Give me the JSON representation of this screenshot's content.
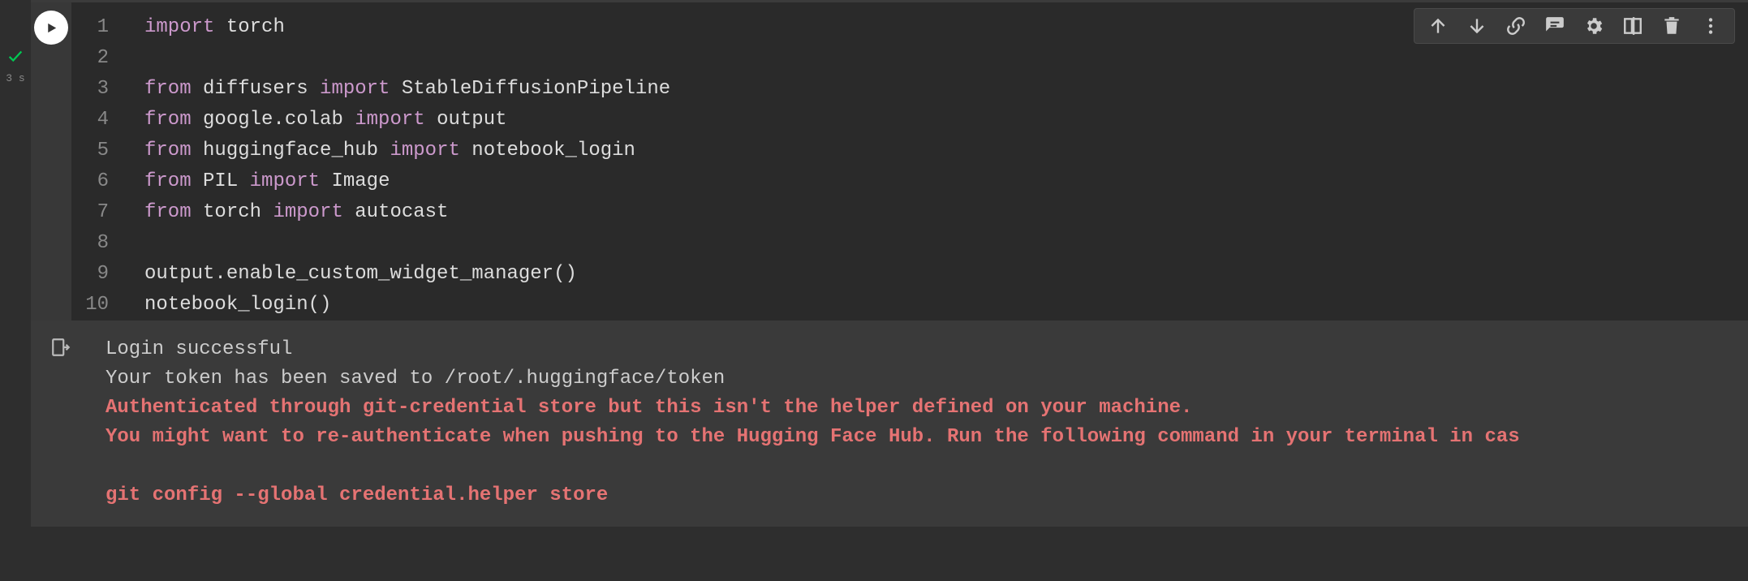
{
  "status": {
    "exec_time": "3 s"
  },
  "gutter": [
    "1",
    "2",
    "3",
    "4",
    "5",
    "6",
    "7",
    "8",
    "9",
    "10"
  ],
  "code": {
    "l1": {
      "kw1": "import",
      "id1": "torch"
    },
    "l3": {
      "kw1": "from",
      "id1": "diffusers",
      "kw2": "import",
      "id2": "StableDiffusionPipeline"
    },
    "l4": {
      "kw1": "from",
      "id1": "google.colab",
      "kw2": "import",
      "id2": "output"
    },
    "l5": {
      "kw1": "from",
      "id1": "huggingface_hub",
      "kw2": "import",
      "id2": "notebook_login"
    },
    "l6": {
      "kw1": "from",
      "id1": "PIL",
      "kw2": "import",
      "id2": "Image"
    },
    "l7": {
      "kw1": "from",
      "id1": "torch",
      "kw2": "import",
      "id2": "autocast"
    },
    "l9": {
      "id1": "output.enable_custom_widget_manager()"
    },
    "l10": {
      "id1": "notebook_login()"
    }
  },
  "output": {
    "line1": "Login successful",
    "line2": "Your token has been saved to /root/.huggingface/token",
    "warn1": "Authenticated through git-credential store but this isn't the helper defined on your machine.",
    "warn2": "You might want to re-authenticate when pushing to the Hugging Face Hub. Run the following command in your terminal in cas",
    "warn3": "",
    "warn4": "git config --global credential.helper store"
  }
}
